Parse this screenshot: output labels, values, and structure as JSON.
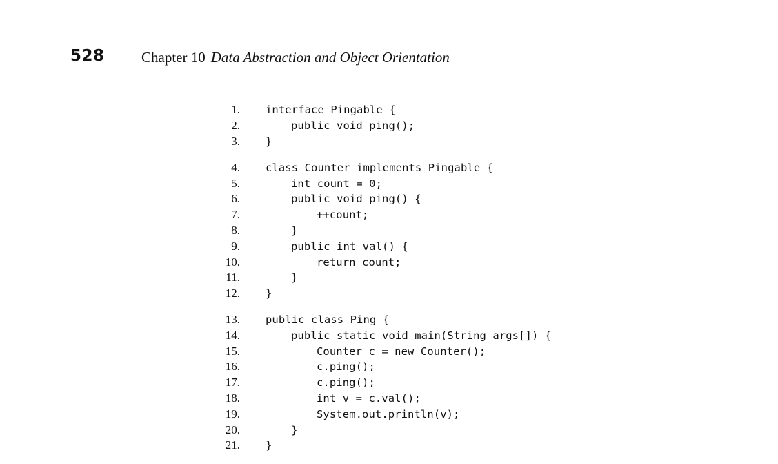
{
  "header": {
    "page_number": "528",
    "chapter_label": "Chapter 10",
    "chapter_title": "Data Abstraction and Object Orientation"
  },
  "code": {
    "blocks": [
      {
        "lines": [
          {
            "num": "1.",
            "text": "interface Pingable {"
          },
          {
            "num": "2.",
            "text": "public void ping();"
          },
          {
            "num": "3.",
            "text": "}"
          }
        ]
      },
      {
        "lines": [
          {
            "num": "4.",
            "text": "class Counter implements Pingable {"
          },
          {
            "num": "5.",
            "text": "int count = 0;"
          },
          {
            "num": "6.",
            "text": "public void ping() {"
          },
          {
            "num": "7.",
            "text": "++count;"
          },
          {
            "num": "8.",
            "text": "}"
          },
          {
            "num": "9.",
            "text": "public int val() {"
          },
          {
            "num": "10.",
            "text": "return count;"
          },
          {
            "num": "11.",
            "text": "}"
          },
          {
            "num": "12.",
            "text": "}"
          }
        ]
      },
      {
        "lines": [
          {
            "num": "13.",
            "text": "public class Ping {"
          },
          {
            "num": "14.",
            "text": "public static void main(String args[]) {"
          },
          {
            "num": "15.",
            "text": "Counter c = new Counter();"
          },
          {
            "num": "16.",
            "text": "c.ping();"
          },
          {
            "num": "17.",
            "text": "c.ping();"
          },
          {
            "num": "18.",
            "text": "int v = c.val();"
          },
          {
            "num": "19.",
            "text": "System.out.println(v);"
          },
          {
            "num": "20.",
            "text": "}"
          },
          {
            "num": "21.",
            "text": "}"
          }
        ]
      }
    ]
  }
}
